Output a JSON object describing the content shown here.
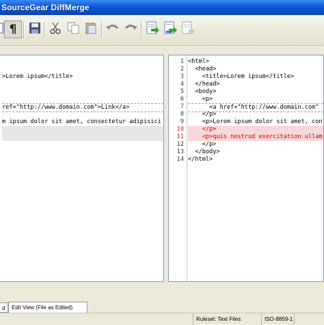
{
  "window": {
    "title": "SourceGear DiffMerge"
  },
  "toolbar": {
    "buttons": [
      {
        "icon": "view-toggle-icon"
      },
      {
        "icon": "pilcrow-icon",
        "glyph": "¶"
      },
      {
        "icon": "save-icon"
      },
      {
        "icon": "cut-icon"
      },
      {
        "icon": "copy-icon"
      },
      {
        "icon": "paste-icon"
      },
      {
        "icon": "undo-icon"
      },
      {
        "icon": "redo-icon"
      },
      {
        "icon": "apply-change-icon"
      },
      {
        "icon": "apply-change-down-icon"
      },
      {
        "icon": "insert-change-icon"
      }
    ]
  },
  "left_pane": {
    "lines": [
      {
        "text": "",
        "type": "normal"
      },
      {
        "text": "",
        "type": "normal"
      },
      {
        "text": ">Lorem ipsum</title>",
        "type": "normal"
      },
      {
        "text": "",
        "type": "normal"
      },
      {
        "text": "",
        "type": "normal"
      },
      {
        "text": "",
        "type": "normal"
      },
      {
        "text": "ref=\"http://www.domain.com\">Link</a>",
        "type": "dashed"
      },
      {
        "text": "",
        "type": "normal"
      },
      {
        "text": "m ipsum dolor sit amet, consectetur adipisici",
        "type": "normal"
      },
      {
        "text": "",
        "type": "shade"
      },
      {
        "text": "",
        "type": "shade"
      },
      {
        "text": "",
        "type": "normal"
      },
      {
        "text": "",
        "type": "normal"
      },
      {
        "text": "",
        "type": "normal"
      }
    ]
  },
  "right_pane": {
    "lines": [
      {
        "num": "1",
        "text": "<html>",
        "type": "normal"
      },
      {
        "num": "2",
        "text": "  <head>",
        "type": "normal"
      },
      {
        "num": "3",
        "text": "    <title>Lorem ipsum</title>",
        "type": "normal"
      },
      {
        "num": "4",
        "text": "  </head>",
        "type": "normal"
      },
      {
        "num": "5",
        "text": "  <body>",
        "type": "normal"
      },
      {
        "num": "6",
        "text": "    <p>",
        "type": "normal"
      },
      {
        "num": "7",
        "text": "      <a href=\"http://www.domain.com\"",
        "type": "dashed"
      },
      {
        "num": "8",
        "text": "    </p>",
        "type": "normal"
      },
      {
        "num": "9",
        "text": "    <p>Lorem ipsum dolor sit amet, con",
        "type": "normal"
      },
      {
        "num": "10",
        "text": "    </p>",
        "type": "changed"
      },
      {
        "num": "11",
        "text": "    <p>quis nostrud exercitation ullam",
        "type": "changed"
      },
      {
        "num": "12",
        "text": "    </p>",
        "type": "normal"
      },
      {
        "num": "13",
        "text": "  </body>",
        "type": "normal"
      },
      {
        "num": "14",
        "text": "</html>",
        "type": "normal"
      }
    ]
  },
  "tabs": [
    {
      "label": "d",
      "active": false
    },
    {
      "label": "Edit View (File as Edited)",
      "active": true
    }
  ],
  "status": {
    "ruleset": "Ruleset: Text Files",
    "encoding": "ISO-8859-1"
  },
  "colors": {
    "changed_bg": "#f7d8d8",
    "changed_text": "#cc0000",
    "title_bar": "#0a58d6"
  }
}
